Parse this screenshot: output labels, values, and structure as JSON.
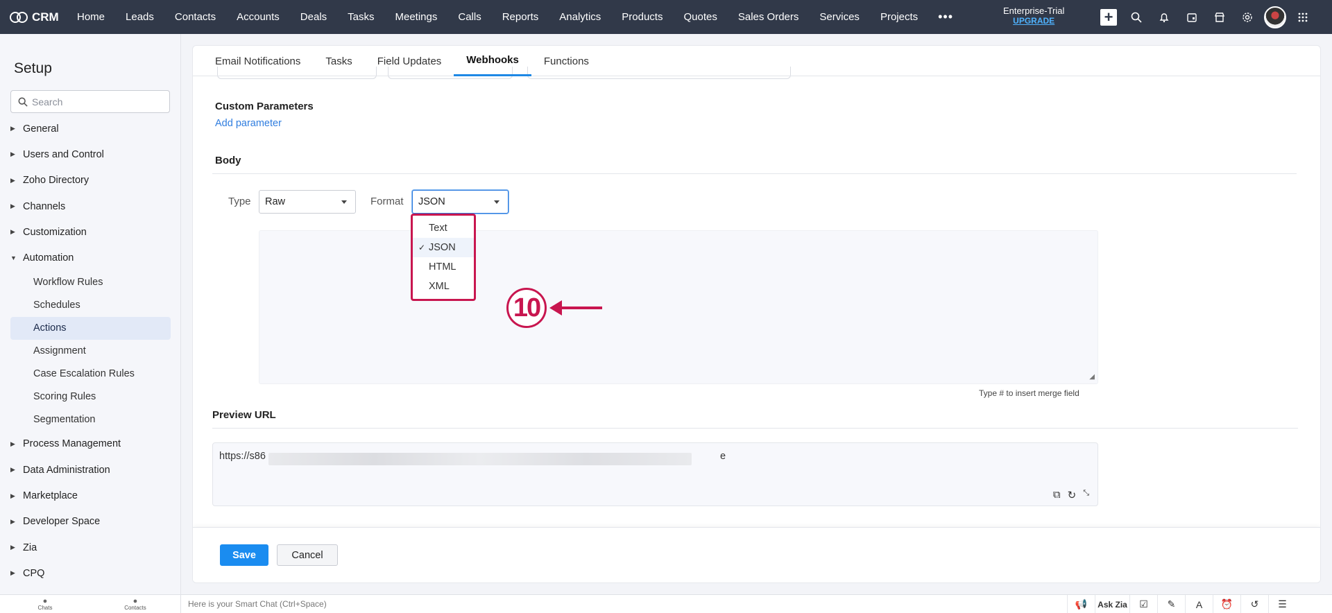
{
  "topbar": {
    "app_name": "CRM",
    "nav": [
      "Home",
      "Leads",
      "Contacts",
      "Accounts",
      "Deals",
      "Tasks",
      "Meetings",
      "Calls",
      "Reports",
      "Analytics",
      "Products",
      "Quotes",
      "Sales Orders",
      "Services",
      "Projects"
    ],
    "more": "•••",
    "trial_label": "Enterprise-Trial",
    "upgrade_label": "UPGRADE"
  },
  "sidebar": {
    "title": "Setup",
    "search_placeholder": "Search",
    "menu_top": [
      "General",
      "Users and Control",
      "Zoho Directory",
      "Channels",
      "Customization"
    ],
    "automation": {
      "label": "Automation",
      "items": [
        "Workflow Rules",
        "Schedules",
        "Actions",
        "Assignment",
        "Case Escalation Rules",
        "Scoring Rules",
        "Segmentation"
      ],
      "active": "Actions"
    },
    "menu_bottom": [
      "Process Management",
      "Data Administration",
      "Marketplace",
      "Developer Space",
      "Zia",
      "CPQ"
    ]
  },
  "tabs": [
    "Email Notifications",
    "Tasks",
    "Field Updates",
    "Webhooks",
    "Functions"
  ],
  "active_tab": "Webhooks",
  "custom_params": {
    "title": "Custom Parameters",
    "add_link": "Add parameter"
  },
  "body": {
    "title": "Body",
    "type_label": "Type",
    "type_value": "Raw",
    "format_label": "Format",
    "format_value": "JSON",
    "format_options": [
      "Text",
      "JSON",
      "HTML",
      "XML"
    ],
    "selected_option": "JSON",
    "merge_hint": "Type # to insert merge field"
  },
  "annotation": {
    "step": "10"
  },
  "preview": {
    "title": "Preview URL",
    "url_start": "https://s86",
    "url_end": "e"
  },
  "actions": {
    "save": "Save",
    "cancel": "Cancel"
  },
  "bottombar": {
    "chats": "Chats",
    "contacts": "Contacts",
    "chat_hint": "Here is your Smart Chat (Ctrl+Space)",
    "ask_zia": "Ask Zia"
  },
  "colors": {
    "topbar": "#313949",
    "accent": "#1a8cf0",
    "annotation": "#c8164f"
  }
}
